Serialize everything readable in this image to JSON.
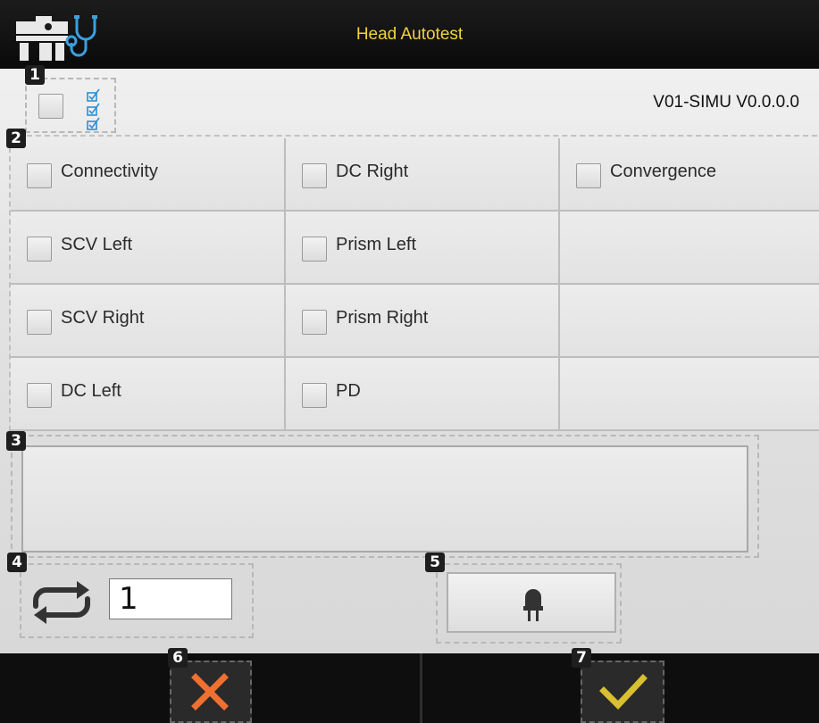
{
  "header": {
    "title": "Head Autotest"
  },
  "badges": {
    "b1": "1",
    "b2": "2",
    "b3": "3",
    "b4": "4",
    "b5": "5",
    "b6": "6",
    "b7": "7"
  },
  "version": "V01-SIMU V0.0.0.0",
  "tests": {
    "connectivity": "Connectivity",
    "dc_right": "DC Right",
    "convergence": "Convergence",
    "scv_left": "SCV Left",
    "prism_left": "Prism Left",
    "scv_right": "SCV Right",
    "prism_right": "Prism Right",
    "dc_left": "DC Left",
    "pd": "PD"
  },
  "repeat": {
    "value": "1"
  },
  "colors": {
    "title": "#f2d23c",
    "cancel": "#f07030",
    "confirm": "#d8c030",
    "check_icon": "#2e8fd0",
    "stethoscope": "#3aa0e0"
  },
  "icons": {
    "app_logo": "device-stethoscope-icon",
    "select_all_list": "checklist-icon",
    "repeat": "repeat-icon",
    "led": "led-icon",
    "cancel": "x-icon",
    "confirm": "check-icon"
  }
}
